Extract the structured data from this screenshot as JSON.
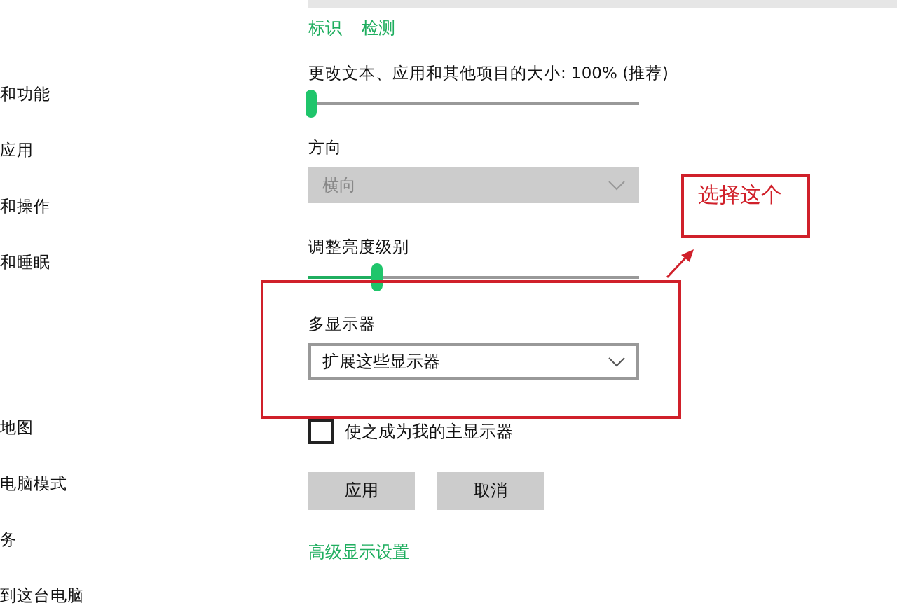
{
  "sidebar": {
    "groups": [
      {
        "items": [
          "和功能",
          "应用",
          "和操作",
          "和睡眠"
        ]
      },
      {
        "items": [
          "地图",
          "电脑模式",
          "务",
          "到这台电脑"
        ]
      }
    ]
  },
  "display": {
    "links": [
      "标识",
      "检测"
    ],
    "scale": {
      "label": "更改文本、应用和其他项目的大小: 100% (推荐)",
      "level": 0
    },
    "orientation": {
      "label": "方向",
      "value": "横向",
      "disabled": true
    },
    "brightness": {
      "label": "调整亮度级别",
      "level": 0.2
    },
    "multiple_displays": {
      "label": "多显示器",
      "value": "扩展这些显示器",
      "disabled": false
    },
    "main_display": {
      "label": "使之成为我的主显示器",
      "checked": false
    },
    "buttons": [
      "应用",
      "取消"
    ],
    "advanced_link": "高级显示设置"
  },
  "annotation": {
    "callout": "选择这个"
  }
}
